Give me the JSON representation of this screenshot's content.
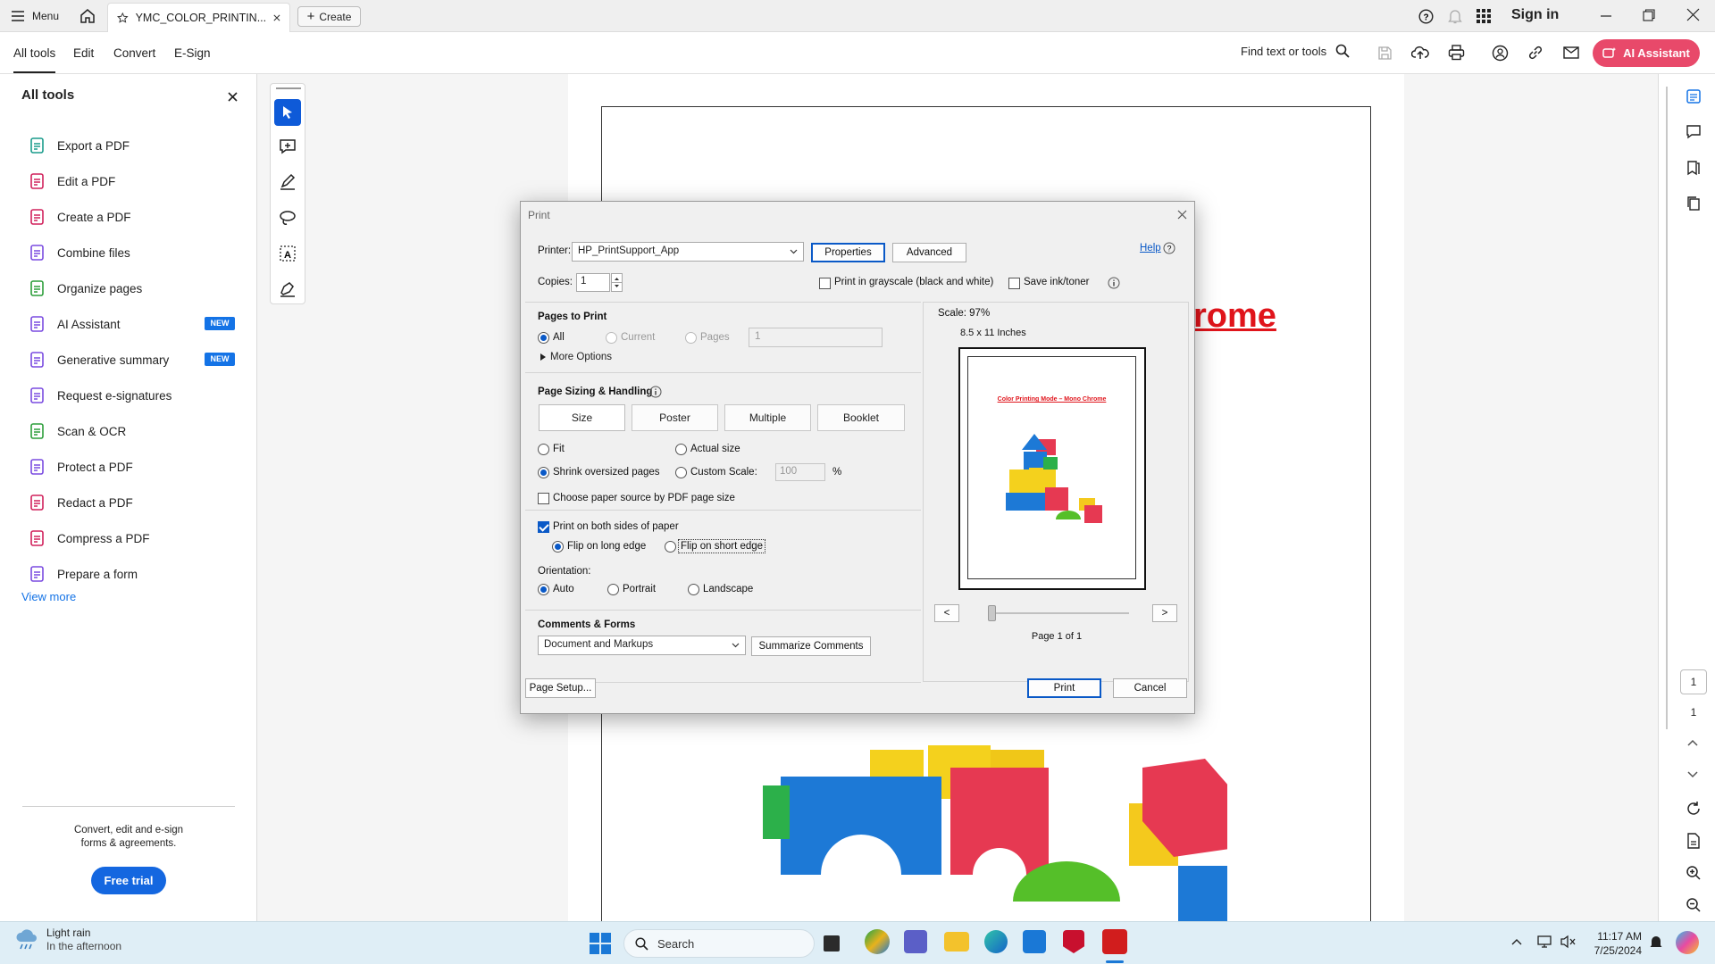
{
  "titlebar": {
    "menu_label": "Menu",
    "tab_title": "YMC_COLOR_PRINTIN...",
    "create_label": "Create",
    "sign_in": "Sign in"
  },
  "toolbar": {
    "menus": [
      "All tools",
      "Edit",
      "Convert",
      "E-Sign"
    ],
    "find_label": "Find text or tools",
    "ai_assistant": "AI Assistant"
  },
  "left_panel": {
    "title": "All tools",
    "items": [
      {
        "label": "Export a PDF",
        "icon": "export-pdf-icon",
        "color": "#1a9c8c"
      },
      {
        "label": "Edit a PDF",
        "icon": "edit-pdf-icon",
        "color": "#d1215b"
      },
      {
        "label": "Create a PDF",
        "icon": "create-pdf-icon",
        "color": "#d1215b"
      },
      {
        "label": "Combine files",
        "icon": "combine-files-icon",
        "color": "#7a4be0"
      },
      {
        "label": "Organize pages",
        "icon": "organize-pages-icon",
        "color": "#2c9e3a"
      },
      {
        "label": "AI Assistant",
        "icon": "ai-assistant-icon",
        "color": "#7a4be0",
        "badge": "NEW"
      },
      {
        "label": "Generative summary",
        "icon": "generative-summary-icon",
        "color": "#7a4be0",
        "badge": "NEW"
      },
      {
        "label": "Request e-signatures",
        "icon": "request-esign-icon",
        "color": "#7a4be0"
      },
      {
        "label": "Scan & OCR",
        "icon": "scan-ocr-icon",
        "color": "#2c9e3a"
      },
      {
        "label": "Protect a PDF",
        "icon": "protect-pdf-icon",
        "color": "#7a4be0"
      },
      {
        "label": "Redact a PDF",
        "icon": "redact-pdf-icon",
        "color": "#d1215b"
      },
      {
        "label": "Compress a PDF",
        "icon": "compress-pdf-icon",
        "color": "#d1215b"
      },
      {
        "label": "Prepare a form",
        "icon": "prepare-form-icon",
        "color": "#7a4be0"
      }
    ],
    "view_more": "View more",
    "promo_text": "Convert, edit and e-sign forms & agreements.",
    "free_trial": "Free trial"
  },
  "document": {
    "heading_fragment": "rome"
  },
  "print_dialog": {
    "title": "Print",
    "help": "Help",
    "printer_label": "Printer:",
    "printer_value": "HP_PrintSupport_App",
    "properties": "Properties",
    "advanced": "Advanced",
    "copies_label": "Copies:",
    "copies_value": "1",
    "grayscale_label": "Print in grayscale (black and white)",
    "save_ink_label": "Save ink/toner",
    "pages_to_print": {
      "title": "Pages to Print",
      "all": "All",
      "current": "Current",
      "pages": "Pages",
      "pages_value": "1",
      "more_options": "More Options"
    },
    "sizing": {
      "title": "Page Sizing & Handling",
      "tabs": [
        "Size",
        "Poster",
        "Multiple",
        "Booklet"
      ],
      "fit": "Fit",
      "actual_size": "Actual size",
      "shrink": "Shrink oversized pages",
      "custom_scale": "Custom Scale:",
      "custom_value": "100",
      "percent": "%",
      "paper_source": "Choose paper source by PDF page size"
    },
    "duplex": {
      "both_sides": "Print on both sides of paper",
      "long_edge": "Flip on long edge",
      "short_edge": "Flip on short edge"
    },
    "orientation": {
      "title": "Orientation:",
      "auto": "Auto",
      "portrait": "Portrait",
      "landscape": "Landscape"
    },
    "comments": {
      "title": "Comments & Forms",
      "value": "Document and Markups",
      "summarize": "Summarize Comments"
    },
    "preview": {
      "scale": "Scale:  97%",
      "paper_size": "8.5 x 11 Inches",
      "doc_title": "Color Printing Mode – Mono Chrome",
      "prev": "<",
      "next": ">",
      "page_count": "Page 1 of 1"
    },
    "page_setup": "Page Setup...",
    "print": "Print",
    "cancel": "Cancel"
  },
  "right_rail": {
    "page_num": "1",
    "page_total": "1"
  },
  "taskbar": {
    "weather_title": "Light rain",
    "weather_sub": "In the afternoon",
    "search_placeholder": "Search",
    "time": "11:17 AM",
    "date": "7/25/2024"
  },
  "colors": {
    "accent": "#1473e6",
    "ai_button": "#e8496a",
    "doc_red": "#e0141b",
    "dialog_blue": "#0a59c7"
  }
}
